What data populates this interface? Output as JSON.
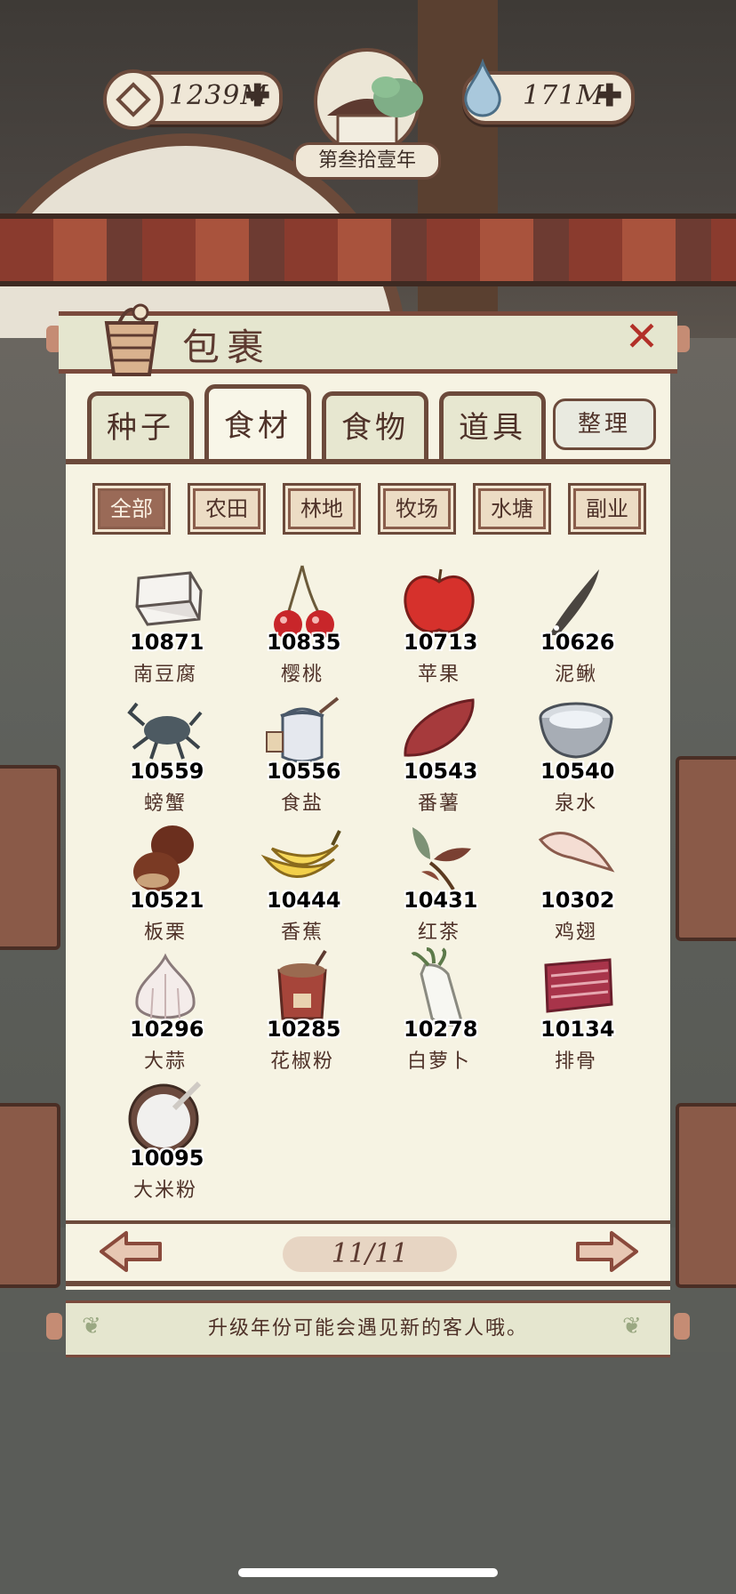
{
  "hud": {
    "coins": "1239M",
    "water": "171M",
    "year_label": "第叁拾壹年",
    "plus": "✚"
  },
  "dialog": {
    "title": "包裹",
    "close": "✕"
  },
  "tabs": [
    {
      "label": "种子"
    },
    {
      "label": "食材"
    },
    {
      "label": "食物"
    },
    {
      "label": "道具"
    }
  ],
  "tidy_label": "整理",
  "active_tab": "食材",
  "filters": [
    {
      "label": "全部"
    },
    {
      "label": "农田"
    },
    {
      "label": "林地"
    },
    {
      "label": "牧场"
    },
    {
      "label": "水塘"
    },
    {
      "label": "副业"
    }
  ],
  "active_filter": "全部",
  "items": [
    {
      "name": "南豆腐",
      "qty": "10871",
      "icon": "tofu-icon"
    },
    {
      "name": "樱桃",
      "qty": "10835",
      "icon": "cherry-icon"
    },
    {
      "name": "苹果",
      "qty": "10713",
      "icon": "apple-icon"
    },
    {
      "name": "泥鳅",
      "qty": "10626",
      "icon": "loach-icon"
    },
    {
      "name": "螃蟹",
      "qty": "10559",
      "icon": "crab-icon"
    },
    {
      "name": "食盐",
      "qty": "10556",
      "icon": "salt-jar-icon"
    },
    {
      "name": "番薯",
      "qty": "10543",
      "icon": "sweet-potato-icon"
    },
    {
      "name": "泉水",
      "qty": "10540",
      "icon": "water-bowl-icon"
    },
    {
      "name": "板栗",
      "qty": "10521",
      "icon": "chestnut-icon"
    },
    {
      "name": "香蕉",
      "qty": "10444",
      "icon": "banana-icon"
    },
    {
      "name": "红茶",
      "qty": "10431",
      "icon": "tea-leaf-icon"
    },
    {
      "name": "鸡翅",
      "qty": "10302",
      "icon": "chicken-wing-icon"
    },
    {
      "name": "大蒜",
      "qty": "10296",
      "icon": "garlic-icon"
    },
    {
      "name": "花椒粉",
      "qty": "10285",
      "icon": "pepper-powder-icon"
    },
    {
      "name": "白萝卜",
      "qty": "10278",
      "icon": "radish-icon"
    },
    {
      "name": "排骨",
      "qty": "10134",
      "icon": "ribs-icon"
    },
    {
      "name": "大米粉",
      "qty": "10095",
      "icon": "rice-flour-icon"
    }
  ],
  "pager": {
    "page": "11/11"
  },
  "tip": "升级年份可能会遇见新的客人哦。",
  "colors": {
    "frame": "#6c4a3b",
    "panel": "#f6f3e3",
    "accent_red": "#b23028"
  }
}
